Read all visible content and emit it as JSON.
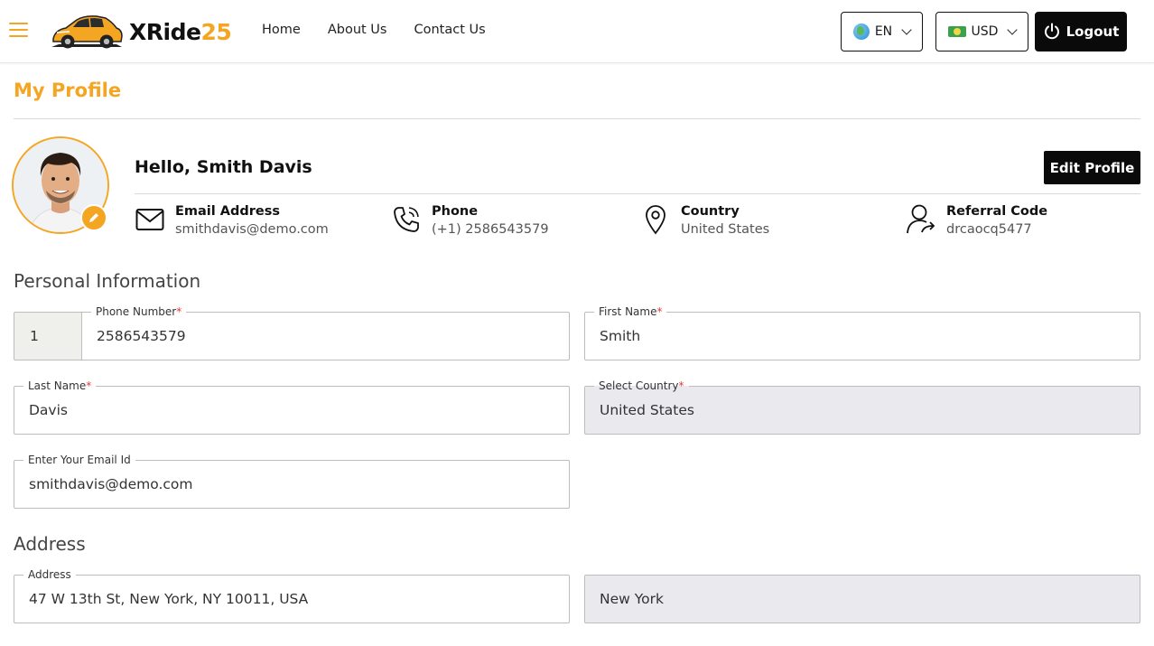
{
  "header": {
    "brand_prefix": "XRide",
    "brand_suffix": "25",
    "nav": [
      "Home",
      "About Us",
      "Contact Us"
    ],
    "language": "EN",
    "currency": "USD",
    "logout_label": "Logout"
  },
  "colors": {
    "accent": "#f4a623",
    "dark": "#0a0a0a",
    "required": "#e53935"
  },
  "profile": {
    "title": "My Profile",
    "greeting": "Hello, Smith Davis",
    "edit_label": "Edit Profile",
    "info": [
      {
        "label": "Email Address",
        "value": "smithdavis@demo.com",
        "icon": "mail-icon"
      },
      {
        "label": "Phone",
        "value": "(+1) 2586543579",
        "icon": "phone-icon"
      },
      {
        "label": "Country",
        "value": "United States",
        "icon": "location-pin-icon"
      },
      {
        "label": "Referral Code",
        "value": "drcaocq5477",
        "icon": "user-share-icon"
      }
    ]
  },
  "personal": {
    "heading": "Personal Information",
    "country_code": "1",
    "phone_label": "Phone Number",
    "phone_value": "2586543579",
    "first_name_label": "First Name",
    "first_name_value": "Smith",
    "last_name_label": "Last Name",
    "last_name_value": "Davis",
    "country_label": "Select Country",
    "country_value": "United States",
    "email_label": "Enter Your Email Id",
    "email_value": "smithdavis@demo.com",
    "required_mark": "*"
  },
  "address": {
    "heading": "Address",
    "address_label": "Address",
    "address_value": "47 W 13th St, New York, NY 10011, USA",
    "city_value": "New York"
  }
}
